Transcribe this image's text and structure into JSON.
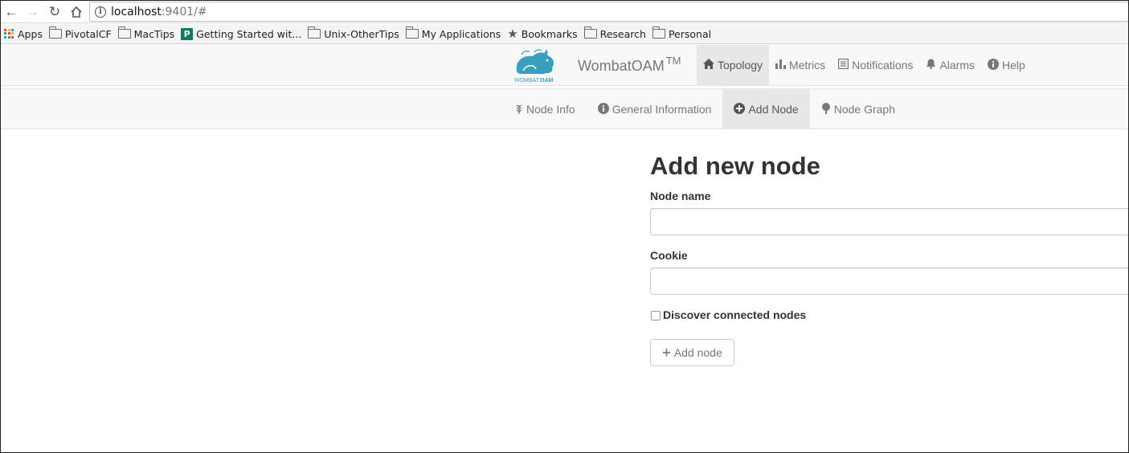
{
  "browser": {
    "url_host": "localhost",
    "url_rest": ":9401/#"
  },
  "bookmarks": [
    {
      "label": "Apps",
      "icon": "apps-grid-icon"
    },
    {
      "label": "PivotalCF",
      "icon": "folder-icon"
    },
    {
      "label": "MacTips",
      "icon": "folder-icon"
    },
    {
      "label": "Getting Started wit...",
      "icon": "p-favicon"
    },
    {
      "label": "Unix-OtherTips",
      "icon": "folder-icon"
    },
    {
      "label": "My Applications",
      "icon": "folder-icon"
    },
    {
      "label": "Bookmarks",
      "icon": "star-icon"
    },
    {
      "label": "Research",
      "icon": "folder-icon"
    },
    {
      "label": "Personal",
      "icon": "folder-icon"
    }
  ],
  "header": {
    "logo_text_left": "WOMBAT",
    "logo_text_right": "OAM",
    "brand": "WombatOAM",
    "brand_tm": "TM",
    "accent_color": "#3a9fbf",
    "nav": [
      {
        "label": "Topology",
        "icon": "home-icon",
        "active": true
      },
      {
        "label": "Metrics",
        "icon": "bar-chart-icon",
        "active": false
      },
      {
        "label": "Notifications",
        "icon": "list-icon",
        "active": false
      },
      {
        "label": "Alarms",
        "icon": "bell-icon",
        "active": false
      },
      {
        "label": "Help",
        "icon": "info-circle-icon",
        "active": false
      }
    ]
  },
  "sub_nav": [
    {
      "label": "Node Info",
      "icon": "grain-icon",
      "active": false
    },
    {
      "label": "General Information",
      "icon": "info-circle-icon",
      "active": false
    },
    {
      "label": "Add Node",
      "icon": "plus-circle-icon",
      "active": true
    },
    {
      "label": "Node Graph",
      "icon": "tree-icon",
      "active": false
    }
  ],
  "form": {
    "title": "Add new node",
    "node_name_label": "Node name",
    "node_name_value": "",
    "cookie_label": "Cookie",
    "cookie_value": "",
    "discover_label": "Discover connected nodes",
    "discover_checked": false,
    "submit_label": "Add node"
  }
}
